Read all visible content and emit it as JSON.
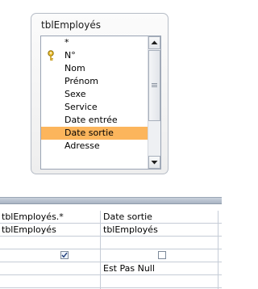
{
  "table_box": {
    "title": "tblEmployés",
    "fields": [
      {
        "label": "*"
      },
      {
        "label": "N°",
        "key": true
      },
      {
        "label": "Nom"
      },
      {
        "label": "Prénom"
      },
      {
        "label": "Sexe"
      },
      {
        "label": "Service"
      },
      {
        "label": "Date entrée"
      },
      {
        "label": "Date sortie",
        "selected": true
      },
      {
        "label": "Adresse"
      }
    ]
  },
  "grid": {
    "columns": [
      {
        "field": "tblEmployés.*",
        "table": "tblEmployés",
        "show": true,
        "criteria": ""
      },
      {
        "field": "Date sortie",
        "table": "tblEmployés",
        "show": false,
        "criteria": "Est Pas Null"
      }
    ]
  },
  "colors": {
    "selection": "#fcb55c",
    "border": "#b6bcc6",
    "splitter": "#a9b4c3"
  }
}
